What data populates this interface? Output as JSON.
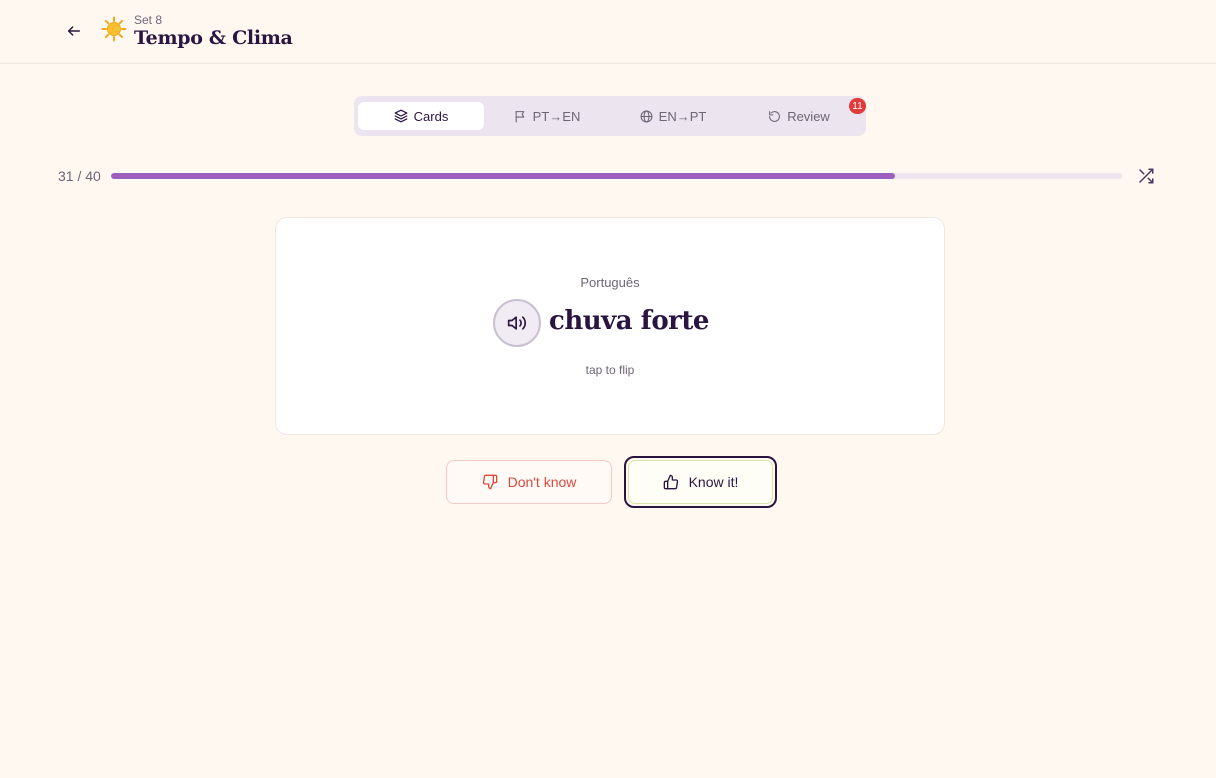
{
  "header": {
    "back_icon": "arrow-left-icon",
    "set_icon": "sun-icon",
    "set_label": "Set 8",
    "set_title": "Tempo & Clima"
  },
  "tabs": [
    {
      "label": "Cards",
      "icon": "layers-icon",
      "active": true
    },
    {
      "label": "PT→EN",
      "icon": "flag-icon",
      "active": false
    },
    {
      "label": "EN→PT",
      "icon": "globe-icon",
      "active": false
    },
    {
      "label": "Review",
      "icon": "rotate-ccw-icon",
      "active": false,
      "badge": "11"
    }
  ],
  "progress": {
    "text": "31 / 40",
    "current": 31,
    "total": 40,
    "fraction": 0.775
  },
  "card": {
    "language": "Português",
    "word": "chuva forte",
    "hint": "tap to flip",
    "audio_icon": "volume-icon"
  },
  "actions": {
    "dont_know_label": "Don't know",
    "know_label": "Know it!"
  },
  "colors": {
    "background": "#fff8f0",
    "accent": "#9b5fbf",
    "text": "#2a1540",
    "danger": "#d94a3c",
    "badge": "#e03a3a"
  }
}
